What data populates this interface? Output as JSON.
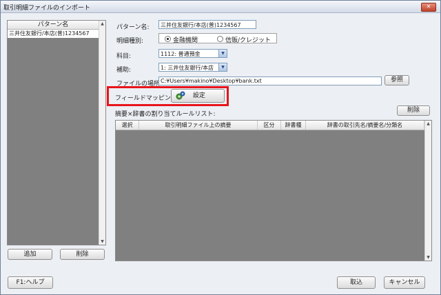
{
  "window": {
    "title": "取引明細ファイルのインポート",
    "close_glyph": "✕"
  },
  "patterns": {
    "header": "パターン名",
    "items": [
      "三井住友銀行/本店(普)1234567"
    ]
  },
  "form": {
    "pattern_name": {
      "label": "パターン名:",
      "value": "三井住友銀行/本店(普)1234567"
    },
    "statement_type": {
      "label": "明細種別:",
      "options": [
        "金融機関",
        "信販/クレジット"
      ],
      "selected": "金融機関"
    },
    "account": {
      "label": "科目:",
      "value": "1112: 普通預金"
    },
    "sub_account": {
      "label": "補助:",
      "value": "1: 三井住友銀行/本店"
    },
    "file_location": {
      "label": "ファイルの場所:",
      "value": "C:¥Users¥makino¥Desktop¥bank.txt",
      "browse": "参照"
    },
    "field_mapping": {
      "label": "フィールドマッピング:",
      "button": "設定"
    }
  },
  "rules": {
    "caption": "摘要×辞書の割り当てルールリスト:",
    "delete_button": "削除",
    "columns": [
      "選択",
      "取引明細ファイル上の摘要",
      "区分",
      "辞書種",
      "辞書の取引先名/摘要名/分類名"
    ]
  },
  "buttons": {
    "add": "追加",
    "delete": "削除",
    "help": "F1:ヘルプ",
    "import": "取込",
    "cancel": "キャンセル"
  },
  "colors": {
    "highlight": "#e8141b",
    "list_bg": "#808080"
  }
}
